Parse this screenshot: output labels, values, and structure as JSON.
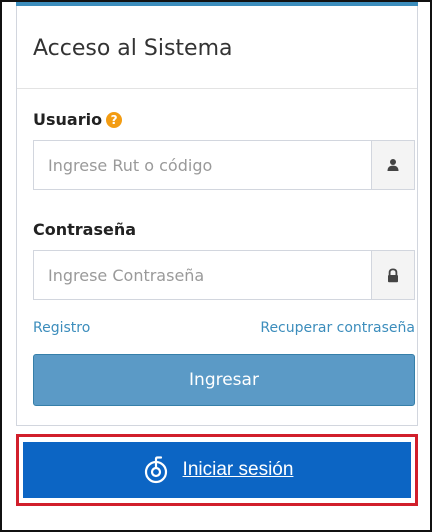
{
  "login_box": {
    "title": "Acceso al Sistema",
    "user_label": "Usuario",
    "help_icon": "question-circle",
    "user_placeholder": "Ingrese Rut o código",
    "user_icon": "user-icon",
    "password_label": "Contraseña",
    "password_placeholder": "Ingrese Contraseña",
    "password_icon": "lock-icon",
    "register_link": "Registro",
    "recover_link": "Recuperar contraseña",
    "submit_label": "Ingresar"
  },
  "sso": {
    "label": "Iniciar sesión",
    "icon": "sso-logo-icon"
  },
  "colors": {
    "accent": "#3c8dbc",
    "submit_button": "#5b9ac6",
    "sso_button": "#0c65c4",
    "highlight_border": "#d11f2b",
    "help_icon": "#f39c12"
  }
}
